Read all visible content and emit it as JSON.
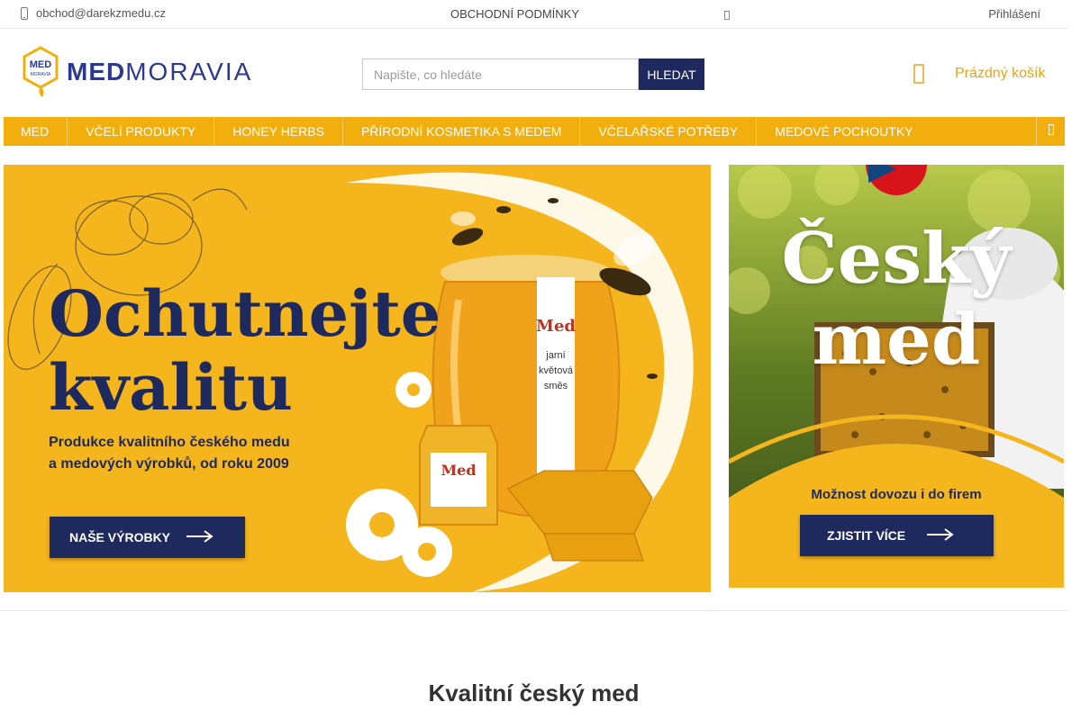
{
  "topbar": {
    "email": "obchod@darekzmedu.cz",
    "terms_link": "OBCHODNÍ PODMÍNKY",
    "login_link": "Přihlášení"
  },
  "header": {
    "logo": {
      "badge_top": "MED",
      "badge_bottom": "MORAVIA",
      "text_bold": "MED",
      "text_light": "MORAVIA"
    },
    "search": {
      "placeholder": "Napište, co hledáte",
      "value": "",
      "button_label": "HLEDAT"
    },
    "cart": {
      "label": "Prázdný košík"
    }
  },
  "nav": {
    "items": [
      {
        "label": "MED"
      },
      {
        "label": "VČELÍ PRODUKTY"
      },
      {
        "label": "HONEY HERBS"
      },
      {
        "label": "PŘÍRODNÍ KOSMETIKA S MEDEM"
      },
      {
        "label": "VČELAŘSKÉ POTŘEBY"
      },
      {
        "label": "MEDOVÉ POCHOUTKY"
      }
    ]
  },
  "banners": {
    "left": {
      "heading_line1": "Ochutnejte",
      "heading_line2": "kvalitu",
      "subtitle_line1": "Produkce kvalitního českého medu",
      "subtitle_line2": "a medových výrobků, od roku 2009",
      "button_label": "NAŠE VÝROBKY",
      "jar_label_top": "Med",
      "jar_label_text": "jarní květová směs",
      "small_jar_label": "Med"
    },
    "right": {
      "heading_line1": "Český",
      "heading_line2": "med",
      "note": "Možnost dovozu i do firem",
      "button_label": "ZJISTIT VÍCE"
    }
  },
  "main": {
    "section_title": "Kvalitní český med"
  },
  "colors": {
    "accent": "#f1ae0c",
    "navy": "#1e2a5e",
    "cart_text": "#e8a21b"
  }
}
